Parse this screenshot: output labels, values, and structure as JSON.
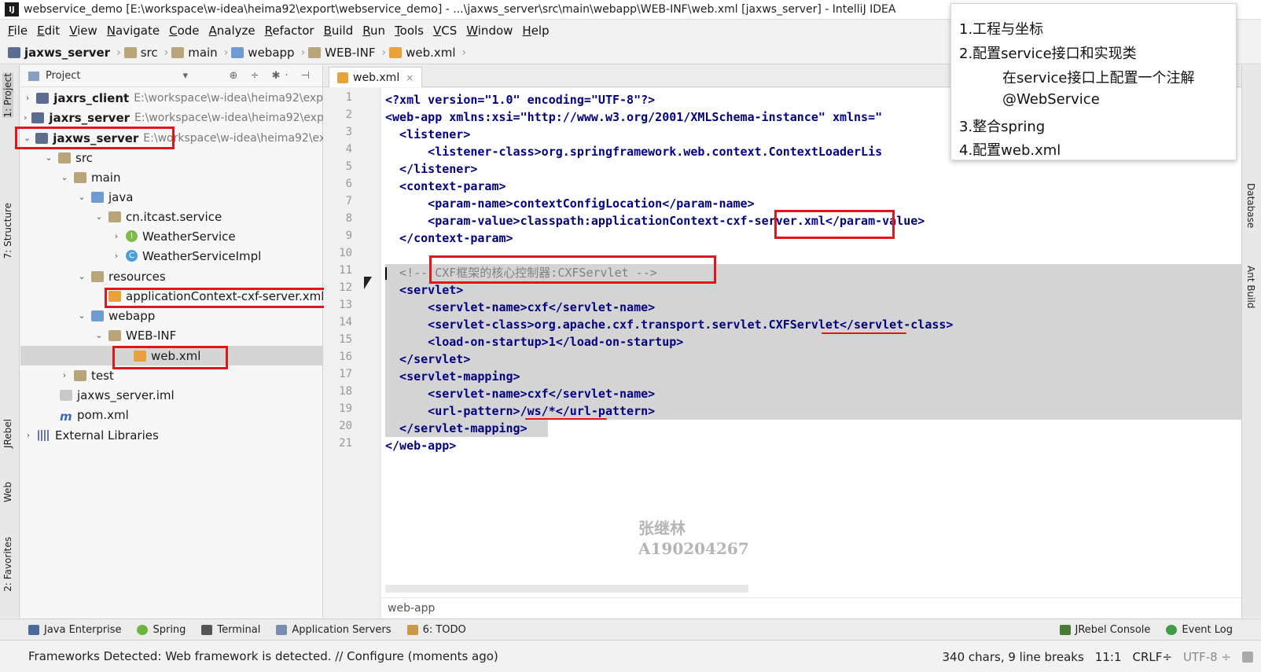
{
  "window": {
    "title": "webservice_demo [E:\\workspace\\w-idea\\heima92\\export\\webservice_demo] - ...\\jaxws_server\\src\\main\\webapp\\WEB-INF\\web.xml [jaxws_server] - IntelliJ IDEA",
    "logo": "IJ"
  },
  "menu": [
    "File",
    "Edit",
    "View",
    "Navigate",
    "Code",
    "Analyze",
    "Refactor",
    "Build",
    "Run",
    "Tools",
    "VCS",
    "Window",
    "Help"
  ],
  "navbar": {
    "crumbs": [
      "jaxws_server",
      "src",
      "main",
      "webapp",
      "WEB-INF",
      "web.xml"
    ]
  },
  "left_strip": {
    "tabs": [
      "1: Project",
      "7: Structure",
      "JRebel",
      "Web",
      "2: Favorites"
    ]
  },
  "right_strip": {
    "tabs": [
      "Database",
      "Ant Build"
    ]
  },
  "project_panel": {
    "title": "Project",
    "tools": "⊕ ÷ ✱· ⊣",
    "tree": [
      {
        "label": "jaxrs_client",
        "path": "E:\\workspace\\w-idea\\heima92\\exp",
        "bold": true
      },
      {
        "label": "jaxrs_server",
        "path": "E:\\workspace\\w-idea\\heima92\\exp",
        "bold": true
      },
      {
        "label": "jaxws_server",
        "path": "E:\\workspace\\w-idea\\heima92\\ex",
        "bold": true
      },
      {
        "label": "src"
      },
      {
        "label": "main"
      },
      {
        "label": "java"
      },
      {
        "label": "cn.itcast.service"
      },
      {
        "label": "WeatherService",
        "badge": "I"
      },
      {
        "label": "WeatherServiceImpl",
        "badge": "C"
      },
      {
        "label": "resources"
      },
      {
        "label": "applicationContext-cxf-server.xml"
      },
      {
        "label": "webapp"
      },
      {
        "label": "WEB-INF"
      },
      {
        "label": "web.xml"
      },
      {
        "label": "test"
      },
      {
        "label": "jaxws_server.iml"
      },
      {
        "label": "pom.xml"
      },
      {
        "label": "External Libraries"
      }
    ]
  },
  "editor": {
    "tab": "web.xml",
    "tab_close": "×",
    "line_numbers": [
      "1",
      "2",
      "3",
      "4",
      "5",
      "6",
      "7",
      "8",
      "9",
      "10",
      "11",
      "12",
      "13",
      "14",
      "15",
      "16",
      "17",
      "18",
      "19",
      "20",
      "21"
    ],
    "lines": [
      "<?xml version=\"1.0\" encoding=\"UTF-8\"?>",
      "<web-app xmlns:xsi=\"http://www.w3.org/2001/XMLSchema-instance\" xmlns=\"",
      "  <listener>",
      "      <listener-class>org.springframework.web.context.ContextLoaderLis",
      "  </listener>",
      "  <context-param>",
      "      <param-name>contextConfigLocation</param-name>",
      "      <param-value>classpath:applicationContext-cxf-server.xml</param-value>",
      "  </context-param>",
      "",
      "  <!-- CXF框架的核心控制器:CXFServlet -->",
      "  <servlet>",
      "      <servlet-name>cxf</servlet-name>",
      "      <servlet-class>org.apache.cxf.transport.servlet.CXFServlet</servlet-class>",
      "      <load-on-startup>1</load-on-startup>",
      "  </servlet>",
      "  <servlet-mapping>",
      "      <servlet-name>cxf</servlet-name>",
      "      <url-pattern>/ws/*</url-pattern>",
      "  </servlet-mapping>",
      "</web-app>"
    ],
    "bottom_breadcrumb": "web-app"
  },
  "watermark": {
    "name": "张继林",
    "id": "A190204267"
  },
  "note": {
    "lines": [
      "1.工程与坐标",
      "2.配置service接口和实现类",
      "在service接口上配置一个注解",
      "@WebService",
      "3.整合spring",
      "4.配置web.xml"
    ]
  },
  "bottom_tools": {
    "left": [
      "Java Enterprise",
      "Spring",
      "Terminal",
      "Application Servers",
      "6: TODO"
    ],
    "right": [
      "JRebel Console",
      "Event Log"
    ]
  },
  "status": {
    "message": "Frameworks Detected: Web framework is detected. // Configure (moments ago)",
    "chars": "340 chars, 9 line breaks",
    "position": "11:1",
    "line_sep": "CRLF÷",
    "encoding": "UTF-8 ÷"
  },
  "colors": {
    "highlight_red": "#e2141c",
    "tag": "#000080",
    "value": "#008000",
    "selection": "#d4d4d4"
  }
}
